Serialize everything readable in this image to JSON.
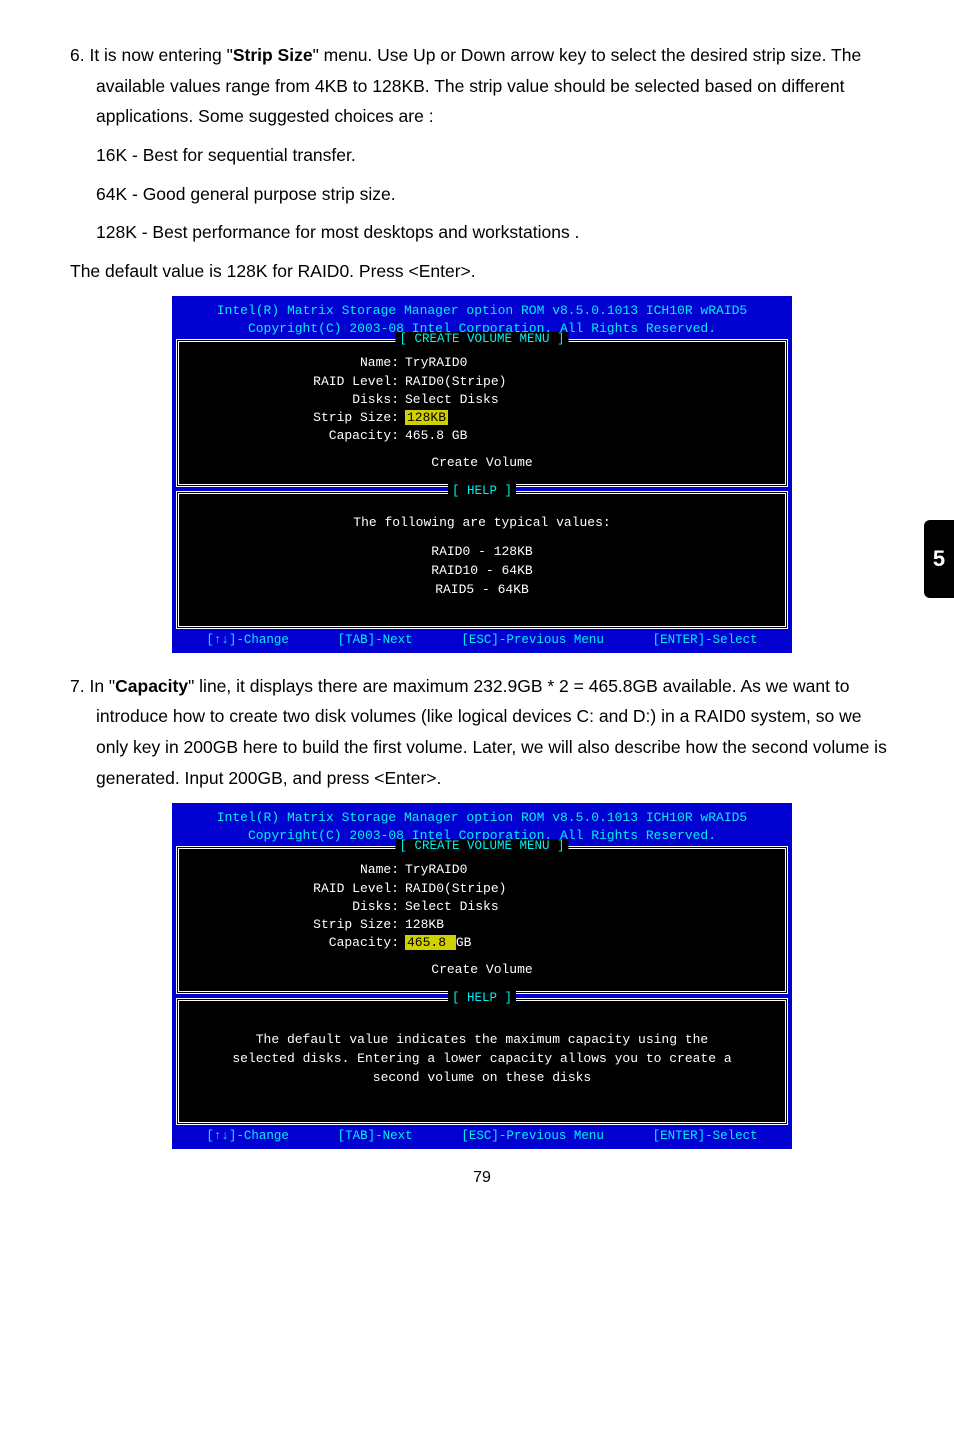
{
  "side_tab": "5",
  "page_number": "79",
  "step6": {
    "main": "6. It is now entering \"",
    "bold1": "Strip Size",
    "main2": "\" menu. Use Up or Down arrow key to select the desired strip size. The available values range from 4KB to 128KB. The strip value should be selected based on different applications. Some suggested choices are :",
    "l1": "16K - Best for sequential transfer.",
    "l2": "64K - Good general purpose strip size.",
    "l3": "128K - Best performance for most desktops and workstations .",
    "last": "The default value is 128K for RAID0. Press <Enter>."
  },
  "bios1": {
    "hdr1": "Intel(R) Matrix Storage Manager option ROM v8.5.0.1013 ICH10R wRAID5",
    "hdr2": "Copyright(C) 2003-08 Intel Corporation.   All Rights Reserved.",
    "box1_title": "[ CREATE VOLUME MENU ]",
    "rows": {
      "name_l": "Name:",
      "name_v": "TryRAID0",
      "raid_l": "RAID Level:",
      "raid_v": "RAID0(Stripe)",
      "disks_l": "Disks:",
      "disks_v": "Select Disks",
      "strip_l": "Strip Size:",
      "strip_v": "128KB",
      "cap_l": "Capacity:",
      "cap_v": "465.8   GB",
      "create": "Create Volume"
    },
    "box2_title": "[ HELP ]",
    "help": {
      "t1": "The following are typical values:",
      "t2": "RAID0   -  128KB",
      "t3": "RAID10 -  64KB",
      "t4": "RAID5   -  64KB"
    },
    "footer": {
      "f1": "[↑↓]-Change",
      "f2": "[TAB]-Next",
      "f3": "[ESC]-Previous Menu",
      "f4": "[ENTER]-Select"
    }
  },
  "step7": {
    "pre": "7. In \"",
    "bold": "Capacity",
    "post": "\" line, it displays there are maximum 232.9GB * 2 = 465.8GB available. As we want to introduce how to create two disk volumes (like logical devices C: and D:) in a RAID0 system, so we only key in 200GB here to build the first volume. Later, we will also describe how the second volume is generated. Input 200GB, and press <Enter>."
  },
  "bios2": {
    "hdr1": "Intel(R) Matrix Storage Manager option ROM v8.5.0.1013 ICH10R wRAID5",
    "hdr2": "Copyright(C) 2003-08 Intel Corporation.   All Rights Reserved.",
    "box1_title": "[ CREATE VOLUME MENU ]",
    "rows": {
      "name_l": "Name:",
      "name_v": "TryRAID0",
      "raid_l": "RAID Level:",
      "raid_v": "RAID0(Stripe)",
      "disks_l": "Disks:",
      "disks_v": "Select Disks",
      "strip_l": "Strip Size:",
      "strip_v": "128KB",
      "cap_l": "Capacity:",
      "cap_v": "465.8 ",
      "cap_v2": " GB",
      "create": "Create Volume"
    },
    "box2_title": "[ HELP ]",
    "help_text": "The default value indicates the maximum capacity using the selected disks. Entering a lower capacity allows you to create a second volume on these disks",
    "footer": {
      "f1": "[↑↓]-Change",
      "f2": "[TAB]-Next",
      "f3": "[ESC]-Previous Menu",
      "f4": "[ENTER]-Select"
    }
  }
}
